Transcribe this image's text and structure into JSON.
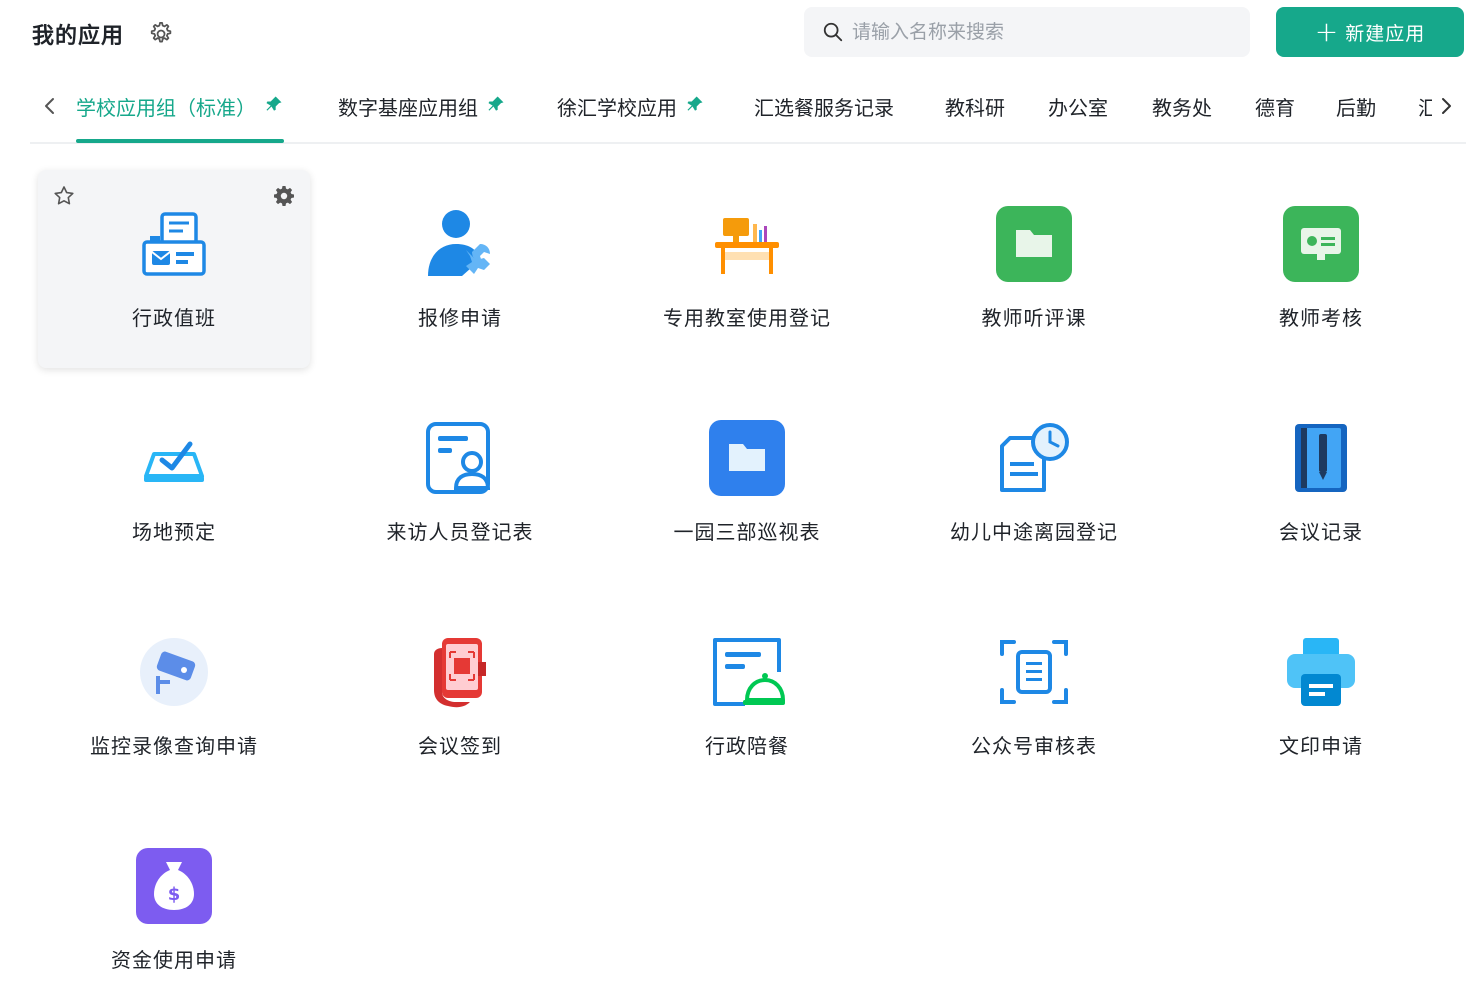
{
  "header": {
    "title": "我的应用",
    "search_placeholder": "请输入名称来搜索",
    "new_app_label": "新建应用"
  },
  "tabs": [
    {
      "label": "学校应用组（标准）",
      "pinned": true,
      "active": true
    },
    {
      "label": "数字基座应用组",
      "pinned": true
    },
    {
      "label": "徐汇学校应用",
      "pinned": true
    },
    {
      "label": "汇选餐服务记录"
    },
    {
      "label": "教科研"
    },
    {
      "label": "办公室"
    },
    {
      "label": "教务处"
    },
    {
      "label": "德育"
    },
    {
      "label": "后勤"
    },
    {
      "label": "汇"
    }
  ],
  "apps": [
    {
      "label": "行政值班",
      "icon": "duty-desk-icon"
    },
    {
      "label": "报修申请",
      "icon": "repair-person-icon"
    },
    {
      "label": "专用教室使用登记",
      "icon": "classroom-desk-icon"
    },
    {
      "label": "教师听评课",
      "icon": "green-folder-icon"
    },
    {
      "label": "教师考核",
      "icon": "green-screen-icon"
    },
    {
      "label": "场地预定",
      "icon": "venue-check-icon"
    },
    {
      "label": "来访人员登记表",
      "icon": "visitor-form-icon"
    },
    {
      "label": "一园三部巡视表",
      "icon": "blue-folder-icon"
    },
    {
      "label": "幼儿中途离园登记",
      "icon": "document-clock-icon"
    },
    {
      "label": "会议记录",
      "icon": "notebook-icon"
    },
    {
      "label": "监控录像查询申请",
      "icon": "camera-icon"
    },
    {
      "label": "会议签到",
      "icon": "phone-scan-icon"
    },
    {
      "label": "行政陪餐",
      "icon": "meal-bell-icon"
    },
    {
      "label": "公众号审核表",
      "icon": "scan-document-icon"
    },
    {
      "label": "文印申请",
      "icon": "printer-icon"
    },
    {
      "label": "资金使用申请",
      "icon": "money-bag-icon"
    }
  ],
  "colors": {
    "accent": "#16a88b",
    "blue": "#1e88e5",
    "green": "#3cb55a",
    "purple": "#7d5cf0",
    "red": "#e53935"
  }
}
